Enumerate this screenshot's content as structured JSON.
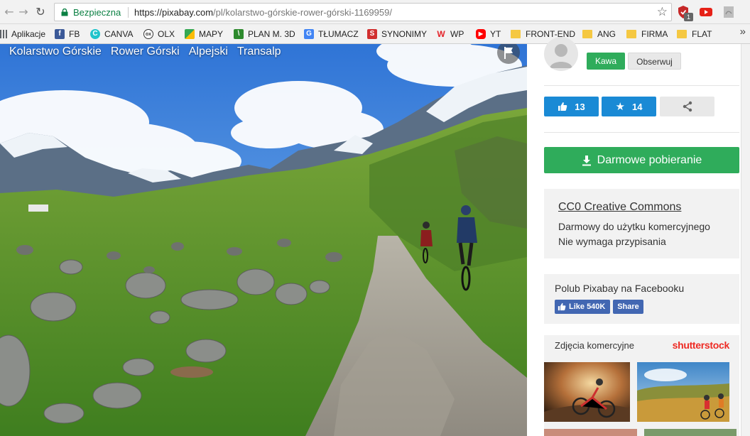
{
  "browser": {
    "secure_label": "Bezpieczna",
    "url_host": "https://pixabay.com",
    "url_path": "/pl/kolarstwo-górskie-rower-górski-1169959/",
    "extension_badge": "1",
    "bookmarks": [
      {
        "label": "Aplikacje",
        "icon": "apps-grid-icon",
        "color": "#5f6368"
      },
      {
        "label": "FB",
        "icon": "facebook-icon",
        "color": "#3b5998"
      },
      {
        "label": "CANVA",
        "icon": "canva-icon",
        "color": "#20c4cb"
      },
      {
        "label": "OLX",
        "icon": "olx-icon",
        "color": "#3a3a3a"
      },
      {
        "label": "MAPY",
        "icon": "google-maps-icon",
        "color": "#34a853"
      },
      {
        "label": "PLAN M. 3D",
        "icon": "plan-icon",
        "color": "#2d8a2d"
      },
      {
        "label": "TŁUMACZ",
        "icon": "google-translate-icon",
        "color": "#4285f4"
      },
      {
        "label": "SYNONIMY",
        "icon": "synonimy-icon",
        "color": "#d12f2f"
      },
      {
        "label": "WP",
        "icon": "wp-icon",
        "color": "#e4242a"
      },
      {
        "label": "YT",
        "icon": "youtube-icon",
        "color": "#ff0000"
      },
      {
        "label": "FRONT-END",
        "icon": "folder-icon",
        "color": "#f5c842"
      },
      {
        "label": "ANG",
        "icon": "folder-icon",
        "color": "#f5c842"
      },
      {
        "label": "FIRMA",
        "icon": "folder-icon",
        "color": "#f5c842"
      },
      {
        "label": "FLAT",
        "icon": "folder-icon",
        "color": "#f5c842"
      }
    ]
  },
  "photo": {
    "tags": [
      "Kolarstwo Górskie",
      "Rower Górski",
      "Alpejski",
      "Transalp"
    ]
  },
  "sidebar": {
    "follow_label": "Kawa",
    "observe_label": "Obserwuj",
    "likes": "13",
    "favorites": "14",
    "download_label": "Darmowe pobieranie",
    "license": {
      "title": "CC0 Creative Commons",
      "line1": "Darmowy do użytku komercyjnego",
      "line2": "Nie wymaga przypisania"
    },
    "facebook": {
      "text": "Polub Pixabay na Facebooku",
      "like_label": "Like 540K",
      "share_label": "Share"
    },
    "shutterstock": {
      "label": "Zdjęcia komercyjne",
      "logo": "shutterstock"
    }
  },
  "colors": {
    "accent_green": "#2fac5b",
    "accent_blue": "#1a8ad5",
    "facebook_blue": "#4267b2",
    "shutterstock_red": "#ee2b24",
    "secure_green": "#0b8043"
  }
}
